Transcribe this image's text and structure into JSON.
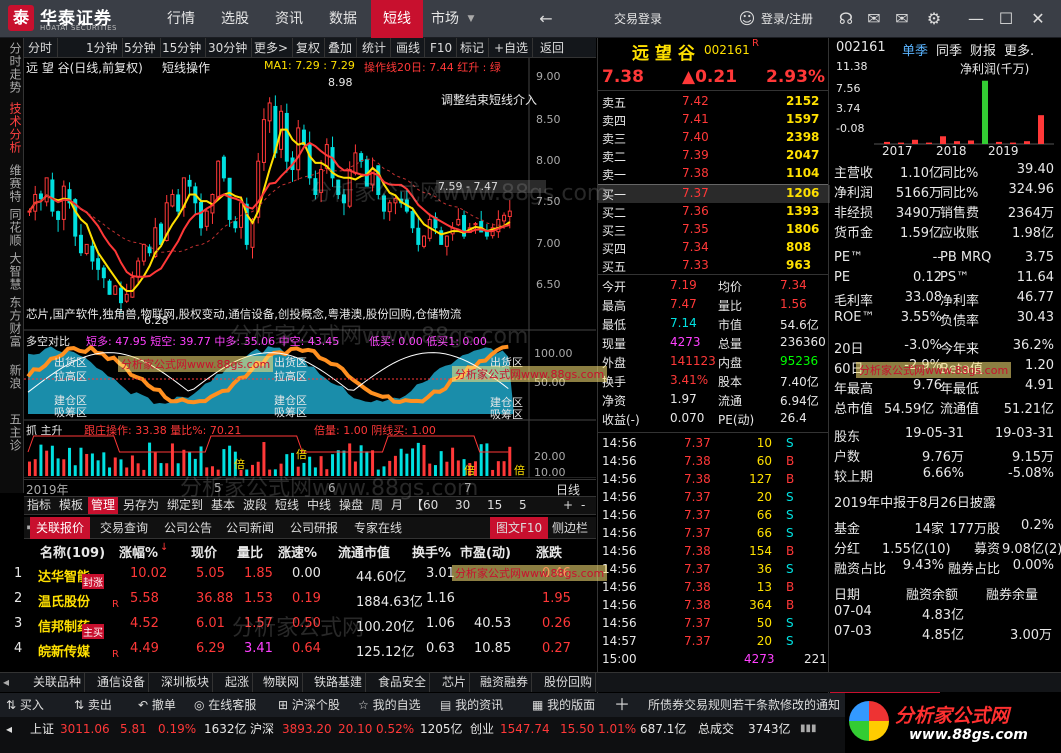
{
  "app": {
    "logo_char": "泰",
    "brand": "华泰证券",
    "brand_en": "HUATAI SECURITIES"
  },
  "nav": [
    "行情",
    "选股",
    "资讯",
    "数据",
    "短线",
    "市场"
  ],
  "nav_extra": {
    "back": "←",
    "trade_login": "交易登录",
    "user": "登录/注册"
  },
  "left_vtabs": [
    "分时走势",
    "技术分析",
    "维赛特",
    "同花顺",
    "大智慧",
    "东方财富",
    "新浪",
    "五主诊"
  ],
  "toolbar": [
    "分时",
    "1分钟",
    "5分钟",
    "15分钟",
    "30分钟",
    "更多>",
    "复权",
    "叠加",
    "统计",
    "画线",
    "F10",
    "标记",
    "+自选",
    "返回"
  ],
  "chart": {
    "header": "远 望 谷(日线,前复权)",
    "mode": "短线操作",
    "ma": "MA1: 7.29  : 7.29",
    "ops": "操作线20日: 7.44 红升 : 绿",
    "y_ticks": [
      "9.00",
      "8.50",
      "8.00",
      "7.50",
      "7.00",
      "6.50"
    ],
    "high_mark": "8.98",
    "low_mark": "6.28",
    "note": "调整结束短线介入",
    "price_band": "7.59 - 7.47",
    "concepts": "芯片,国产软件,独角兽,物联网,股权变动,通信设备,创投概念,粤港澳,股份回购,仓储物流",
    "ind1_title": "多空对比",
    "ind1_vals": "短多: 47.95   短空: 39.77  中多: 35.06  中空: 43.45",
    "ind1_extra": "低买: 0.00  低买1: 0.00",
    "ind1_y": [
      "100.00",
      "50.00"
    ],
    "ind1_labels": [
      "出货区",
      "拉高区",
      "建仓区",
      "吸筹区"
    ],
    "ind2_title": "抓 主升",
    "ind2_vals": "跟庄操作: 33.38  量比%: 70.21",
    "ind2_extra": "倍量: 1.00   阴线买: 1.00",
    "ind2_y": [
      "20.00",
      "10.00"
    ],
    "x_dates": [
      "2019年",
      "5",
      "6",
      "7",
      "日线"
    ],
    "buy_mark": "倍"
  },
  "chart_tabs": [
    "指标",
    "模板",
    "管理",
    "另存为",
    "绑定到",
    "基本",
    "波段",
    "短线",
    "中线",
    "操盘",
    "周",
    "月",
    "【60",
    "30",
    "15",
    "5"
  ],
  "panel_tabs": [
    "关联报价",
    "交易查询",
    "公司公告",
    "公司新闻",
    "公司研报",
    "专家在线"
  ],
  "panel_tabs_right": [
    "图文F10",
    "侧边栏"
  ],
  "ranking": {
    "headers": [
      "名称(109)",
      "涨幅%",
      "现价",
      "量比",
      "涨速%",
      "流通市值",
      "换手%",
      "市盈(动)",
      "涨跌"
    ],
    "rows": [
      {
        "n": "1",
        "name": "达华智能",
        "tag": "封涨",
        "chg": "10.02",
        "price": "5.05",
        "vr": "1.85",
        "spd": "0.00",
        "cap": "44.60亿",
        "turn": "3.01",
        "pe": "",
        "diff": "0.46"
      },
      {
        "n": "2",
        "name": "温氏股份",
        "tag": "R",
        "chg": "5.58",
        "price": "36.88",
        "vr": "1.53",
        "spd": "0.19",
        "cap": "1884.63亿",
        "turn": "1.16",
        "pe": "",
        "diff": "1.95"
      },
      {
        "n": "3",
        "name": "信邦制药",
        "tag": "主买",
        "chg": "4.52",
        "price": "6.01",
        "vr": "1.57",
        "spd": "0.50",
        "cap": "100.20亿",
        "turn": "1.06",
        "pe": "40.53",
        "diff": "0.26"
      },
      {
        "n": "4",
        "name": "皖新传媒",
        "tag": "R",
        "chg": "4.49",
        "price": "6.29",
        "vr": "3.41",
        "spd": "0.64",
        "cap": "125.12亿",
        "turn": "0.63",
        "pe": "10.85",
        "diff": "0.27"
      }
    ]
  },
  "quote": {
    "name": "远 望 谷",
    "code": "002161",
    "flag": "R",
    "price": "7.38",
    "change": "▲0.21",
    "pct": "2.93%",
    "asks": [
      [
        "卖五",
        "7.42",
        "2152"
      ],
      [
        "卖四",
        "7.41",
        "1597"
      ],
      [
        "卖三",
        "7.40",
        "2398"
      ],
      [
        "卖二",
        "7.39",
        "2047"
      ],
      [
        "卖一",
        "7.38",
        "1104"
      ]
    ],
    "bids": [
      [
        "买一",
        "7.37",
        "1206"
      ],
      [
        "买二",
        "7.36",
        "1393"
      ],
      [
        "买三",
        "7.35",
        "1806"
      ],
      [
        "买四",
        "7.34",
        "808"
      ],
      [
        "买五",
        "7.33",
        "963"
      ]
    ],
    "stats": [
      [
        "今开",
        "7.19",
        "均价",
        "7.34"
      ],
      [
        "最高",
        "7.47",
        "量比",
        "1.56"
      ],
      [
        "最低",
        "7.14",
        "市值",
        "54.6亿"
      ],
      [
        "现量",
        "4273",
        "总量",
        "236360"
      ],
      [
        "外盘",
        "141123",
        "内盘",
        "95236"
      ],
      [
        "换手",
        "3.41%",
        "股本",
        "7.40亿"
      ],
      [
        "净资",
        "1.97",
        "流通",
        "6.94亿"
      ],
      [
        "收益(-)",
        "0.070",
        "PE(动)",
        "26.4"
      ]
    ],
    "ticks": [
      [
        "14:56",
        "7.37",
        "10",
        "S"
      ],
      [
        "14:56",
        "7.38",
        "60",
        "B"
      ],
      [
        "14:56",
        "7.38",
        "127",
        "B"
      ],
      [
        "14:56",
        "7.37",
        "20",
        "S"
      ],
      [
        "14:56",
        "7.37",
        "66",
        "S"
      ],
      [
        "14:56",
        "7.37",
        "66",
        "S"
      ],
      [
        "14:56",
        "7.38",
        "154",
        "B"
      ],
      [
        "14:56",
        "7.37",
        "36",
        "S"
      ],
      [
        "14:56",
        "7.38",
        "13",
        "B"
      ],
      [
        "14:56",
        "7.38",
        "364",
        "B"
      ],
      [
        "14:56",
        "7.37",
        "50",
        "S"
      ],
      [
        "14:57",
        "7.37",
        "20",
        "S"
      ],
      [
        "15:00",
        "",
        "4273",
        "221"
      ]
    ],
    "bottom_tabs": [
      "笔",
      "价",
      "细",
      "势",
      "联",
      "值",
      "主",
      "筹"
    ]
  },
  "right": {
    "code": "002161",
    "tabs": [
      "单季",
      "同季",
      "财报",
      "更多."
    ],
    "fin_title": "净利润(千万)",
    "fin_y": [
      "11.38",
      "7.56",
      "3.74",
      "-0.08"
    ],
    "fin_x": [
      "2017",
      "2018",
      "2019"
    ],
    "fin_bars": [
      0.3,
      0.2,
      0.6,
      0.2,
      1.1,
      0.4,
      0.5,
      9.0,
      0.3,
      0.2,
      0.4,
      4.1
    ],
    "rows1": [
      [
        "主营收",
        "1.10亿",
        "同比%",
        "39.40"
      ],
      [
        "净利润",
        "5166万",
        "同比%",
        "324.96"
      ],
      [
        "非经损",
        "3490万",
        "销售费",
        "2364万"
      ],
      [
        "货币金",
        "1.59亿",
        "应收账",
        "1.98亿"
      ]
    ],
    "rows2": [
      [
        "PE™",
        "--",
        "PB MRQ",
        "3.75"
      ],
      [
        "PE",
        "0.12",
        "PS™",
        "11.64"
      ],
      [
        "毛利率",
        "33.08",
        "净利率",
        "46.77"
      ],
      [
        "ROE™",
        "3.55%",
        "负债率",
        "30.43"
      ]
    ],
    "rows3": [
      [
        "20日",
        "-3.0%",
        "今年来",
        "36.2%"
      ],
      [
        "60日",
        "-2.9%",
        "Beta值",
        "1.20"
      ],
      [
        "年最高",
        "9.76",
        "年最低",
        "4.91"
      ],
      [
        "总市值",
        "54.59亿",
        "流通值",
        "51.21亿"
      ]
    ],
    "rows4": [
      [
        "股东",
        "19-05-31",
        "19-03-31"
      ],
      [
        "户数",
        "9.76万",
        "9.15万"
      ],
      [
        "较上期",
        "6.66%",
        "-5.08%"
      ]
    ],
    "report_note": "2019年中报于8月26日披露",
    "rows5": [
      [
        "基金",
        "14家",
        "177万股",
        "0.2%"
      ],
      [
        "分红",
        "1.55亿(10)",
        "募资",
        "9.08亿(2)"
      ],
      [
        "融资占比",
        "9.43%",
        "融券占比",
        "0.00%"
      ]
    ],
    "margin_head": [
      "日期",
      "融资余额",
      "融券余量"
    ],
    "margin_rows": [
      [
        "07-04",
        "4.83亿",
        ""
      ],
      [
        "07-03",
        "4.85亿",
        "3.00万"
      ]
    ],
    "bottom_tabs": [
      "财务简况",
      "公司简介"
    ]
  },
  "strip": [
    "关联品种",
    "通信设备",
    "深圳板块",
    "起涨",
    "物联网",
    "铁路基建",
    "食品安全",
    "芯片",
    "融资融券",
    "股份回购"
  ],
  "actions": [
    "买入",
    "卖出",
    "撤单",
    "在线客服",
    "沪深个股",
    "我的自选",
    "我的资讯",
    "我的版面"
  ],
  "ticker_msg": "所债券交易规则若干条款修改的通知",
  "status": {
    "sh_label": "上证",
    "sh_val": "3011.06",
    "sh_chg": "5.81",
    "sh_pct": "0.19%",
    "sh_amt": "1632亿",
    "hs_label": "沪深",
    "hs_val": "3893.20",
    "hs_chg": "20.10",
    "hs_pct": "0.52%",
    "hs_amt": "1205亿",
    "cy_label": "创业",
    "cy_val": "1547.74",
    "cy_chg": "15.50",
    "cy_pct": "1.01%",
    "cy_amt": "687.1亿",
    "total_label": "总成交",
    "total_val": "3743亿"
  },
  "watermark": "分析家公式网www.88gs.com",
  "watermark_short": "分析家公式网",
  "ad": {
    "title": "分析家公式网",
    "url": "www.88gs.com"
  },
  "colors": {
    "up": "#ff3838",
    "down": "#00e0e0",
    "brand": "#c8102e"
  }
}
